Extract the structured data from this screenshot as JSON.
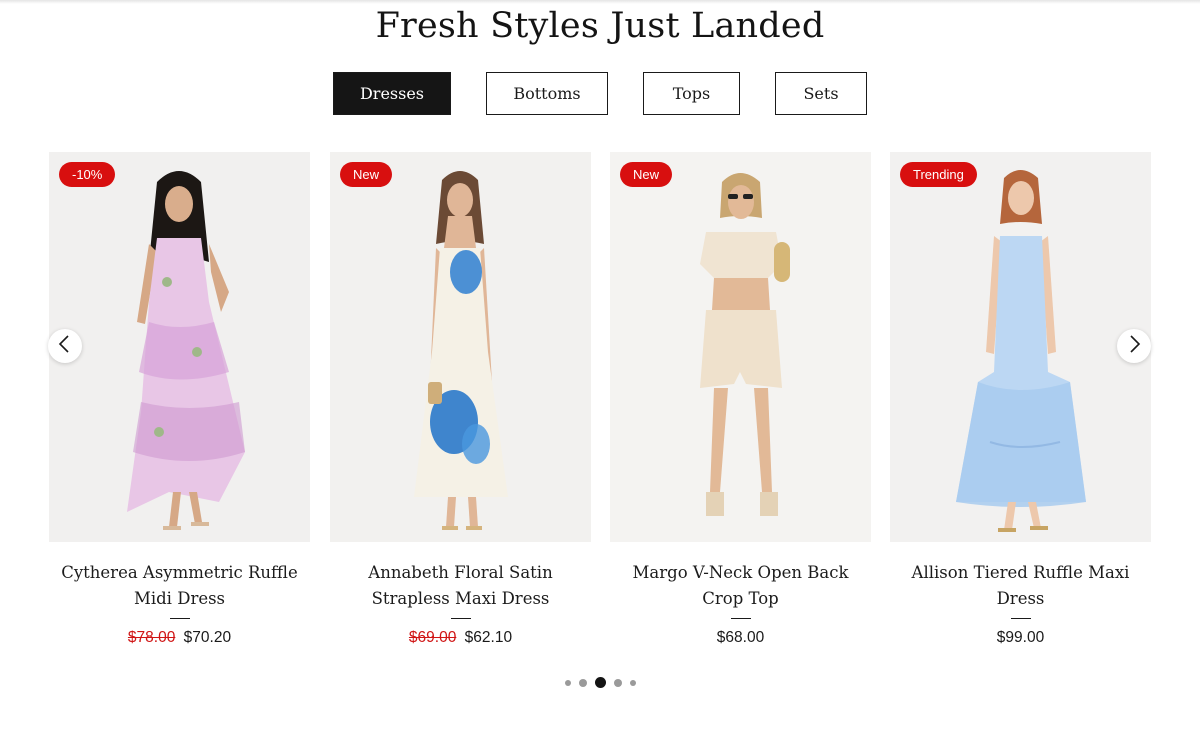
{
  "section": {
    "title": "Fresh Styles Just Landed"
  },
  "tabs": [
    {
      "label": "Dresses",
      "active": true
    },
    {
      "label": "Bottoms",
      "active": false
    },
    {
      "label": "Tops",
      "active": false
    },
    {
      "label": "Sets",
      "active": false
    }
  ],
  "products": [
    {
      "badge": "-10%",
      "name": "Cytherea Asymmetric Ruffle Midi Dress",
      "old_price": "$78.00",
      "price": "$70.20"
    },
    {
      "badge": "New",
      "name": "Annabeth Floral Satin Strapless Maxi Dress",
      "old_price": "$69.00",
      "price": "$62.10"
    },
    {
      "badge": "New",
      "name": "Margo V-Neck Open Back Crop Top",
      "old_price": "",
      "price": "$68.00"
    },
    {
      "badge": "Trending",
      "name": "Allison Tiered Ruffle Maxi Dress",
      "old_price": "",
      "price": "$99.00"
    }
  ],
  "carousel": {
    "prev_icon": "chevron-left-icon",
    "next_icon": "chevron-right-icon",
    "page_count": 5,
    "current_page": 3
  },
  "colors": {
    "badge": "#d80f0f",
    "sale_price": "#d01515",
    "active_tab": "#151515"
  }
}
